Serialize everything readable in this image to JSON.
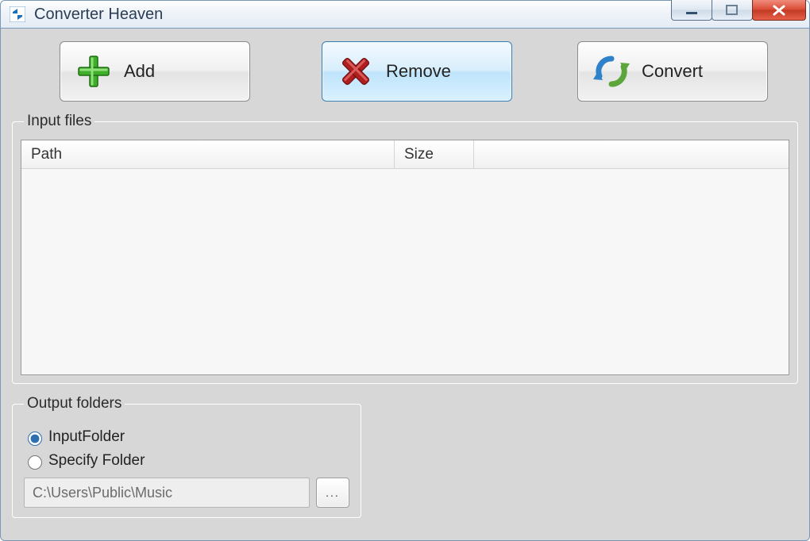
{
  "window": {
    "title": "Converter Heaven"
  },
  "toolbar": {
    "add_label": "Add",
    "remove_label": "Remove",
    "convert_label": "Convert"
  },
  "input_files": {
    "legend": "Input files",
    "columns": {
      "path": "Path",
      "size": "Size"
    },
    "rows": []
  },
  "output_folders": {
    "legend": "Output folders",
    "option_input_folder": "InputFolder",
    "option_specify_folder": "Specify Folder",
    "selected": "input_folder",
    "path_value": "C:\\Users\\Public\\Music",
    "browse_label": "..."
  }
}
